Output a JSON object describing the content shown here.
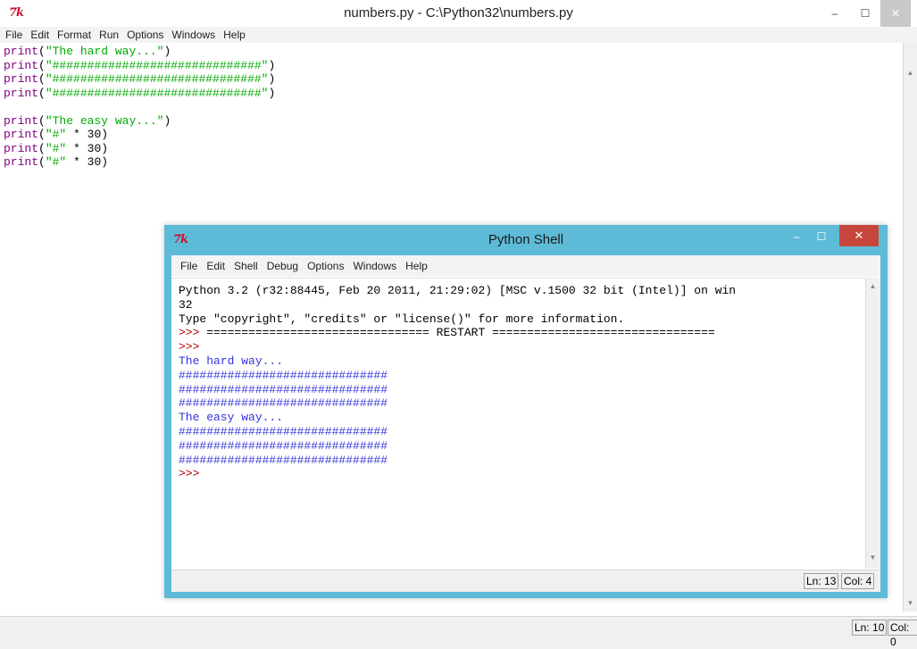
{
  "editor": {
    "title": "numbers.py - C:\\Python32\\numbers.py",
    "menu": [
      "File",
      "Edit",
      "Format",
      "Run",
      "Options",
      "Windows",
      "Help"
    ],
    "code_lines": [
      {
        "kw": "print",
        "paren_open": "(",
        "str": "\"The hard way...\"",
        "rest": ")"
      },
      {
        "kw": "print",
        "paren_open": "(",
        "str": "\"##############################\"",
        "rest": ")"
      },
      {
        "kw": "print",
        "paren_open": "(",
        "str": "\"##############################\"",
        "rest": ")"
      },
      {
        "kw": "print",
        "paren_open": "(",
        "str": "\"##############################\"",
        "rest": ")"
      },
      {
        "kw": "",
        "paren_open": "",
        "str": "",
        "rest": ""
      },
      {
        "kw": "print",
        "paren_open": "(",
        "str": "\"The easy way...\"",
        "rest": ")"
      },
      {
        "kw": "print",
        "paren_open": "(",
        "str": "\"#\"",
        "rest": " * 30)"
      },
      {
        "kw": "print",
        "paren_open": "(",
        "str": "\"#\"",
        "rest": " * 30)"
      },
      {
        "kw": "print",
        "paren_open": "(",
        "str": "\"#\"",
        "rest": " * 30)"
      }
    ],
    "status_ln": "Ln: 10",
    "status_col": "Col: 0",
    "window_buttons": {
      "minimize": "–",
      "maximize": "☐",
      "close": "✕"
    }
  },
  "shell": {
    "title": "Python Shell",
    "menu": [
      "File",
      "Edit",
      "Shell",
      "Debug",
      "Options",
      "Windows",
      "Help"
    ],
    "lines": [
      {
        "text": "Python 3.2 (r32:88445, Feb 20 2011, 21:29:02) [MSC v.1500 32 bit (Intel)] on win",
        "kind": "plain"
      },
      {
        "text": "32",
        "kind": "plain"
      },
      {
        "text": "Type \"copyright\", \"credits\" or \"license()\" for more information.",
        "kind": "plain"
      },
      {
        "text": ">>> ================================ RESTART ================================",
        "kind": "prompt"
      },
      {
        "text": ">>>",
        "kind": "prompt"
      },
      {
        "text": "The hard way...",
        "kind": "out"
      },
      {
        "text": "##############################",
        "kind": "out"
      },
      {
        "text": "##############################",
        "kind": "out"
      },
      {
        "text": "##############################",
        "kind": "out"
      },
      {
        "text": "The easy way...",
        "kind": "out"
      },
      {
        "text": "##############################",
        "kind": "out"
      },
      {
        "text": "##############################",
        "kind": "out"
      },
      {
        "text": "##############################",
        "kind": "out"
      },
      {
        "text": ">>>",
        "kind": "prompt"
      }
    ],
    "status_ln": "Ln: 13",
    "status_col": "Col: 4",
    "window_buttons": {
      "minimize": "–",
      "maximize": "☐",
      "close": "✕"
    }
  },
  "icons": {
    "app_logo": "7k",
    "scroll_up": "▲",
    "scroll_down": "▼"
  }
}
